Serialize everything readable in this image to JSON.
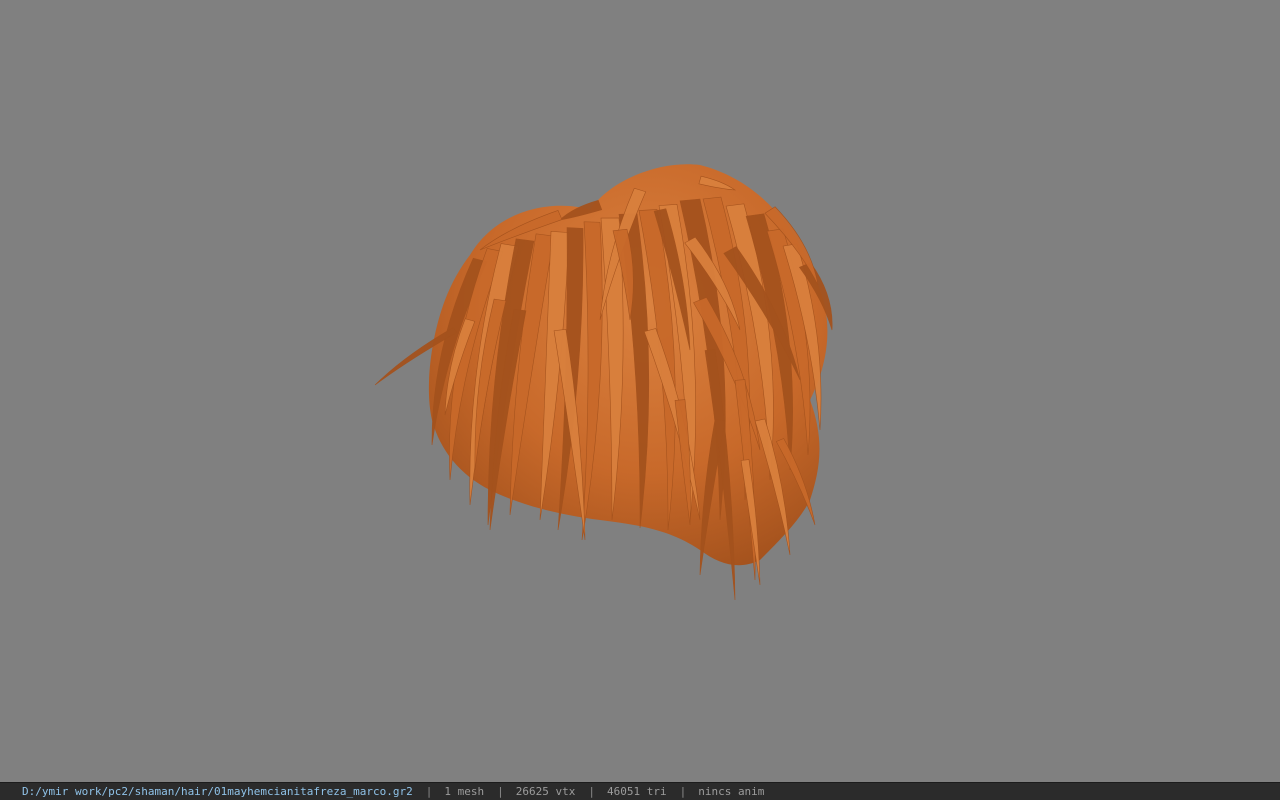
{
  "viewport": {
    "background_color": "#808080",
    "model_color": "#c8692a",
    "model_shade_color": "#a4521d",
    "model_highlight_color": "#d9803d",
    "model_icon": "hair-mesh"
  },
  "statusbar": {
    "file_path": "D:/ymir work/pc2/shaman/hair/01mayhemcianitafreza_marco.gr2",
    "separator": "|",
    "mesh_count": "1 mesh",
    "vertex_count": "26625 vtx",
    "triangle_count": "46051 tri",
    "animation_status": "nincs anim"
  }
}
